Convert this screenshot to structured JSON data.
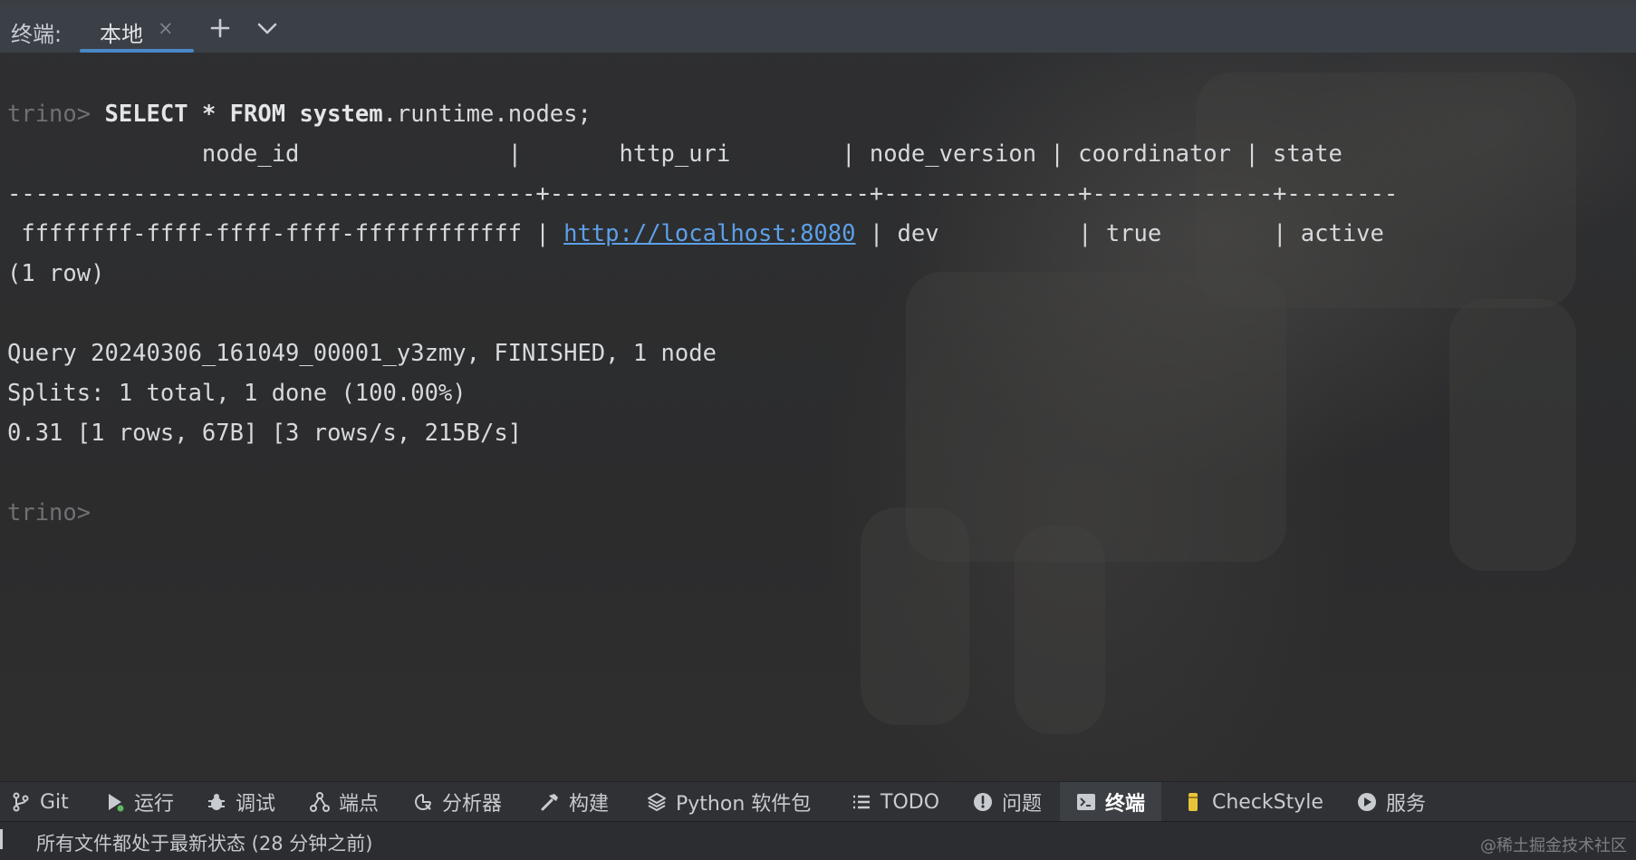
{
  "tabbar": {
    "prefix": "终端:",
    "tab_label": "本地",
    "close_glyph": "×"
  },
  "terminal": {
    "prompt": "trino>",
    "command_keyword1": "SELECT * FROM",
    "command_bold": "system",
    "command_rest": ".runtime.nodes;",
    "table_header": "              node_id               |       http_uri        | node_version | coordinator | state",
    "table_separator": "--------------------------------------+-----------------------+--------------+-------------+--------",
    "row_node_id": " ffffffff-ffff-ffff-ffff-ffffffffffff | ",
    "row_uri": "http://localhost:8080",
    "row_rest": " | dev          | true        | active",
    "row_count": "(1 row)",
    "query_line": "Query 20240306_161049_00001_y3zmy, FINISHED, 1 node",
    "splits_line": "Splits: 1 total, 1 done (100.00%)",
    "stats_line": "0.31 [1 rows, 67B] [3 rows/s, 215B/s]",
    "final_prompt": "trino>"
  },
  "toolbar": {
    "items": [
      {
        "label": "Git",
        "icon": "git-branch-icon"
      },
      {
        "label": "运行",
        "icon": "run-icon"
      },
      {
        "label": "调试",
        "icon": "bug-icon"
      },
      {
        "label": "端点",
        "icon": "endpoints-icon"
      },
      {
        "label": "分析器",
        "icon": "profiler-icon"
      },
      {
        "label": "构建",
        "icon": "hammer-icon"
      },
      {
        "label": "Python 软件包",
        "icon": "layers-icon"
      },
      {
        "label": "TODO",
        "icon": "list-icon"
      },
      {
        "label": "问题",
        "icon": "problems-icon"
      },
      {
        "label": "终端",
        "icon": "terminal-icon",
        "active": true
      },
      {
        "label": "CheckStyle",
        "icon": "checkstyle-icon"
      },
      {
        "label": "服务",
        "icon": "services-icon"
      }
    ]
  },
  "statusbar": {
    "text": "所有文件都处于最新状态 (28 分钟之前)",
    "watermark": "@稀土掘金技术社区"
  },
  "colors": {
    "link": "#5c9fe8",
    "tab_underline": "#4a88c7",
    "run_green": "#5fb85f",
    "checkstyle_yellow": "#e8c43a"
  }
}
